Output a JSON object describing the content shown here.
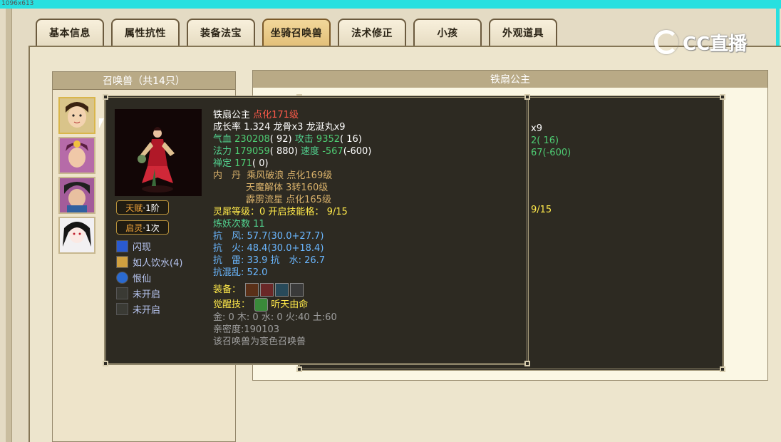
{
  "header": {
    "dimension_text": "1096x613"
  },
  "tabs": [
    {
      "label": "基本信息",
      "active": false
    },
    {
      "label": "属性抗性",
      "active": false
    },
    {
      "label": "装备法宝",
      "active": false
    },
    {
      "label": "坐骑召唤兽",
      "active": true
    },
    {
      "label": "法术修正",
      "active": false
    },
    {
      "label": "小孩",
      "active": false
    },
    {
      "label": "外观道具",
      "active": false
    }
  ],
  "logo": {
    "text": "CC直播"
  },
  "summon_list": {
    "title": "召唤兽（共14只）"
  },
  "detail_panel": {
    "title": "铁扇公主"
  },
  "behind_fragments": [
    "x9",
    "2( 16)",
    "67(-600)",
    "9/15"
  ],
  "tooltip": {
    "name": "铁扇公主",
    "level": "点化171级",
    "growth_line": "成长率 1.324 龙骨x3 龙涎丸x9",
    "hp_label": "气血",
    "hp_value": "230208",
    "hp_extra": "( 92)",
    "atk_label": "攻击",
    "atk_value": "9352",
    "atk_extra": "( 16)",
    "mp_label": "法力",
    "mp_value": "179059",
    "mp_extra": "( 880)",
    "spd_label": "速度",
    "spd_value": "-567",
    "spd_extra": "(-600)",
    "zen_label": "禅定",
    "zen_value": "171",
    "zen_extra": "( 0)",
    "neidan_label": "内　丹",
    "neidan": [
      "乘风破浪 点化169级",
      "天魔解体 3转160级",
      "霹雳流星 点化165级"
    ],
    "lingxi_label": "灵犀等级：",
    "lingxi_value": "0 开启技能格：",
    "lingxi_slots": "9/15",
    "lianyao": "炼妖次数 11",
    "res_wind": "抗　风: 57.7(30.0+27.7)",
    "res_fire": "抗　火: 48.4(30.0+18.4)",
    "res_thunder": "抗　雷: 33.9 抗　水: 26.7",
    "res_chaos": "抗混乱: 52.0",
    "equip_label": "装备：",
    "awaken_label": "觉醒技：",
    "awaken_skill": "听天由命",
    "elements": "金: 0 木: 0 水: 0 火:40 土:60",
    "intimacy": "亲密度:190103",
    "note": "该召唤兽为变色召唤兽",
    "badge_talent_a": "天赋",
    "badge_talent_b": "·1阶",
    "badge_qiling_a": "启灵",
    "badge_qiling_b": "·1次",
    "skills": [
      "闪现",
      "如人饮水(4)",
      "恨仙",
      "未开启",
      "未开启"
    ]
  },
  "icons": [
    "shield-icon",
    "fan-icon",
    "ring-icon",
    "lock-icon",
    "lock-icon",
    "leaf-icon"
  ]
}
